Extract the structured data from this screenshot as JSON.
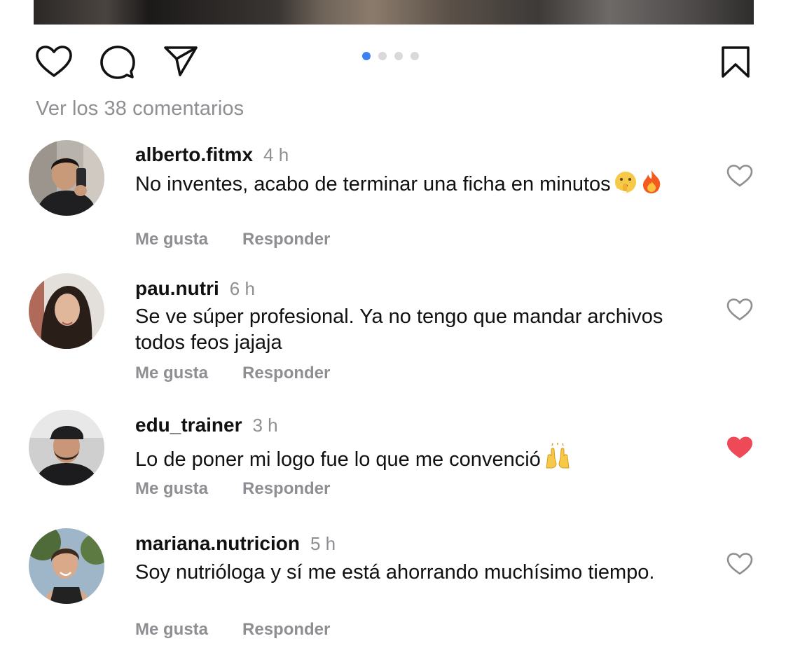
{
  "post": {
    "carousel": {
      "count": 4,
      "active_index": 0,
      "active_color": "#3b82f6",
      "inactive_color": "#d9d9dd"
    },
    "actions": {
      "like_icon": "heart-outline-icon",
      "comment_icon": "comment-bubble-icon",
      "share_icon": "paper-plane-icon",
      "save_icon": "bookmark-icon"
    },
    "view_comments_label": "Ver los 38 comentarios"
  },
  "comments": [
    {
      "username": "alberto.fitmx",
      "time": "4 h",
      "text": "No inventes, acabo de terminar una ficha en minutos",
      "emojis": [
        "shushing-face-emoji",
        "fire-emoji"
      ],
      "like_label": "Me gusta",
      "reply_label": "Responder",
      "liked": false
    },
    {
      "username": "pau.nutri",
      "time": "6 h",
      "text": "Se ve súper profesional. Ya no tengo que mandar archivos todos feos jajaja",
      "emojis": [],
      "like_label": "Me gusta",
      "reply_label": "Responder",
      "liked": false
    },
    {
      "username": "edu_trainer",
      "time": "3 h",
      "text": "Lo de poner mi logo fue lo que me convenció",
      "emojis": [
        "raising-hands-emoji"
      ],
      "like_label": "Me gusta",
      "reply_label": "Responder",
      "liked": true
    },
    {
      "username": "mariana.nutricion",
      "time": "5 h",
      "text": "Soy nutrióloga y sí me está ahorrando muchísimo tiempo.",
      "emojis": [],
      "like_label": "Me gusta",
      "reply_label": "Responder",
      "liked": false
    }
  ],
  "colors": {
    "heart_liked": "#ed4956",
    "secondary_text": "#8e8e93",
    "primary_text": "#111111"
  }
}
